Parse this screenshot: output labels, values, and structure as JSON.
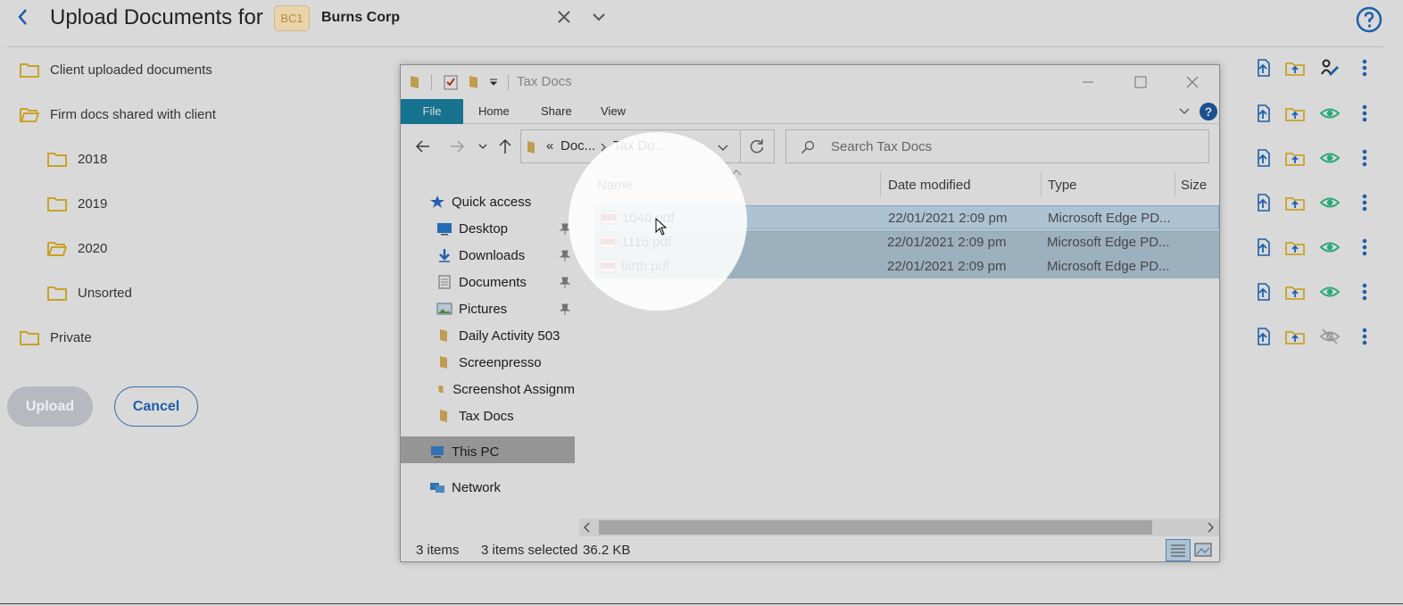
{
  "header": {
    "title": "Upload Documents for",
    "client_code": "BC1",
    "client_name": "Burns Corp"
  },
  "folders": [
    {
      "label": "Client uploaded documents"
    },
    {
      "label": "Firm docs shared with client"
    },
    {
      "label": "2018"
    },
    {
      "label": "2019"
    },
    {
      "label": "2020"
    },
    {
      "label": "Unsorted"
    },
    {
      "label": "Private"
    }
  ],
  "buttons": {
    "upload": "Upload",
    "cancel": "Cancel"
  },
  "explorer": {
    "title": "Tax Docs",
    "ribbon_tabs": [
      "File",
      "Home",
      "Share",
      "View"
    ],
    "address": {
      "prefix": "«",
      "crumb1": "Doc...",
      "crumb2": "Tax Do..."
    },
    "search_placeholder": "Search Tax Docs",
    "nav_items": [
      {
        "label": "Quick access"
      },
      {
        "label": "Desktop"
      },
      {
        "label": "Downloads"
      },
      {
        "label": "Documents"
      },
      {
        "label": "Pictures"
      },
      {
        "label": "Daily Activity 503"
      },
      {
        "label": "Screenpresso"
      },
      {
        "label": "Screenshot Assignm"
      },
      {
        "label": "Tax Docs"
      },
      {
        "label": "This PC"
      },
      {
        "label": "Network"
      }
    ],
    "columns": {
      "name": "Name",
      "date": "Date modified",
      "type": "Type",
      "size": "Size"
    },
    "files": [
      {
        "name": "1040.pdf",
        "date": "22/01/2021 2:09 pm",
        "type": "Microsoft Edge PD..."
      },
      {
        "name": "1116.pdf",
        "date": "22/01/2021 2:09 pm",
        "type": "Microsoft Edge PD..."
      },
      {
        "name": "birth.pdf",
        "date": "22/01/2021 2:09 pm",
        "type": "Microsoft Edge PD..."
      }
    ],
    "status": {
      "items": "3 items",
      "selected": "3 items selected",
      "size": "36.2 KB"
    }
  },
  "colors": {
    "accent_blue": "#1e5fa8",
    "folder": "#c9a227",
    "eye_green": "#2aa876",
    "ribbon_file": "#1a86a8"
  }
}
